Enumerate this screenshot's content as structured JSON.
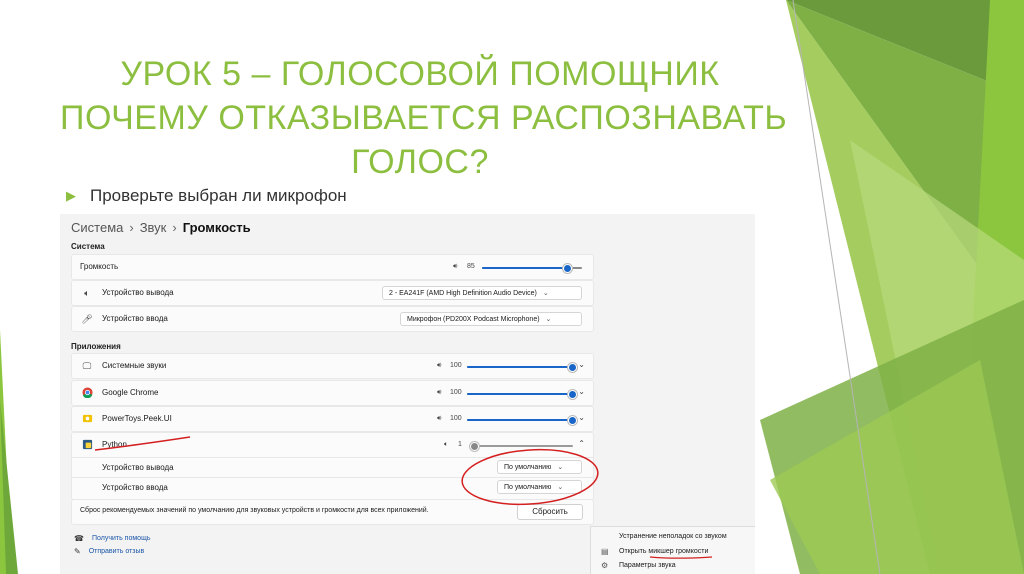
{
  "slide": {
    "title_lines": [
      "УРОК 5 – ГОЛОСОВОЙ ПОМОЩНИК",
      "ПОЧЕМУ ОТКАЗЫВАЕТСЯ РАСПОЗНАВАТЬ",
      "ГОЛОС?"
    ],
    "bullet": "Проверьте выбран ли микрофон",
    "accent_color": "#8cbf3f"
  },
  "screenshot": {
    "breadcrumb": [
      "Система",
      "Звук",
      "Громкость"
    ],
    "system_section": {
      "heading": "Система",
      "volume_label": "Громкость",
      "volume_value": "85",
      "volume_level": 0.85,
      "output_label": "Устройство вывода",
      "output_device": "2 - EA241F (AMD High Definition Audio Device)",
      "input_label": "Устройство ввода",
      "input_device": "Микрофон (PD200X Podcast Microphone)"
    },
    "apps_section": {
      "heading": "Приложения",
      "apps": [
        {
          "name": "Системные звуки",
          "volume": "100",
          "level": 1.0,
          "icon": "monitor-icon"
        },
        {
          "name": "Google Chrome",
          "volume": "100",
          "level": 1.0,
          "icon": "chrome-icon"
        },
        {
          "name": "PowerToys.Peek.UI",
          "volume": "100",
          "level": 1.0,
          "icon": "powertoys-icon"
        },
        {
          "name": "Python",
          "volume": "1",
          "level": 0.01,
          "icon": "python-icon"
        }
      ],
      "python_output_label": "Устройство вывода",
      "python_output_value": "По умолчанию",
      "python_input_label": "Устройство ввода",
      "python_input_value": "По умолчанию"
    },
    "reset_text": "Сброс рекомендуемых значений по умолчанию для звуковых устройств и громкости для всех приложений.",
    "reset_button": "Сбросить",
    "links": {
      "help": "Получить помощь",
      "feedback": "Отправить отзыв"
    },
    "context_menu": [
      "Устранение неполадок со звуком",
      "Открыть микшер громкости",
      "Параметры звука"
    ]
  }
}
